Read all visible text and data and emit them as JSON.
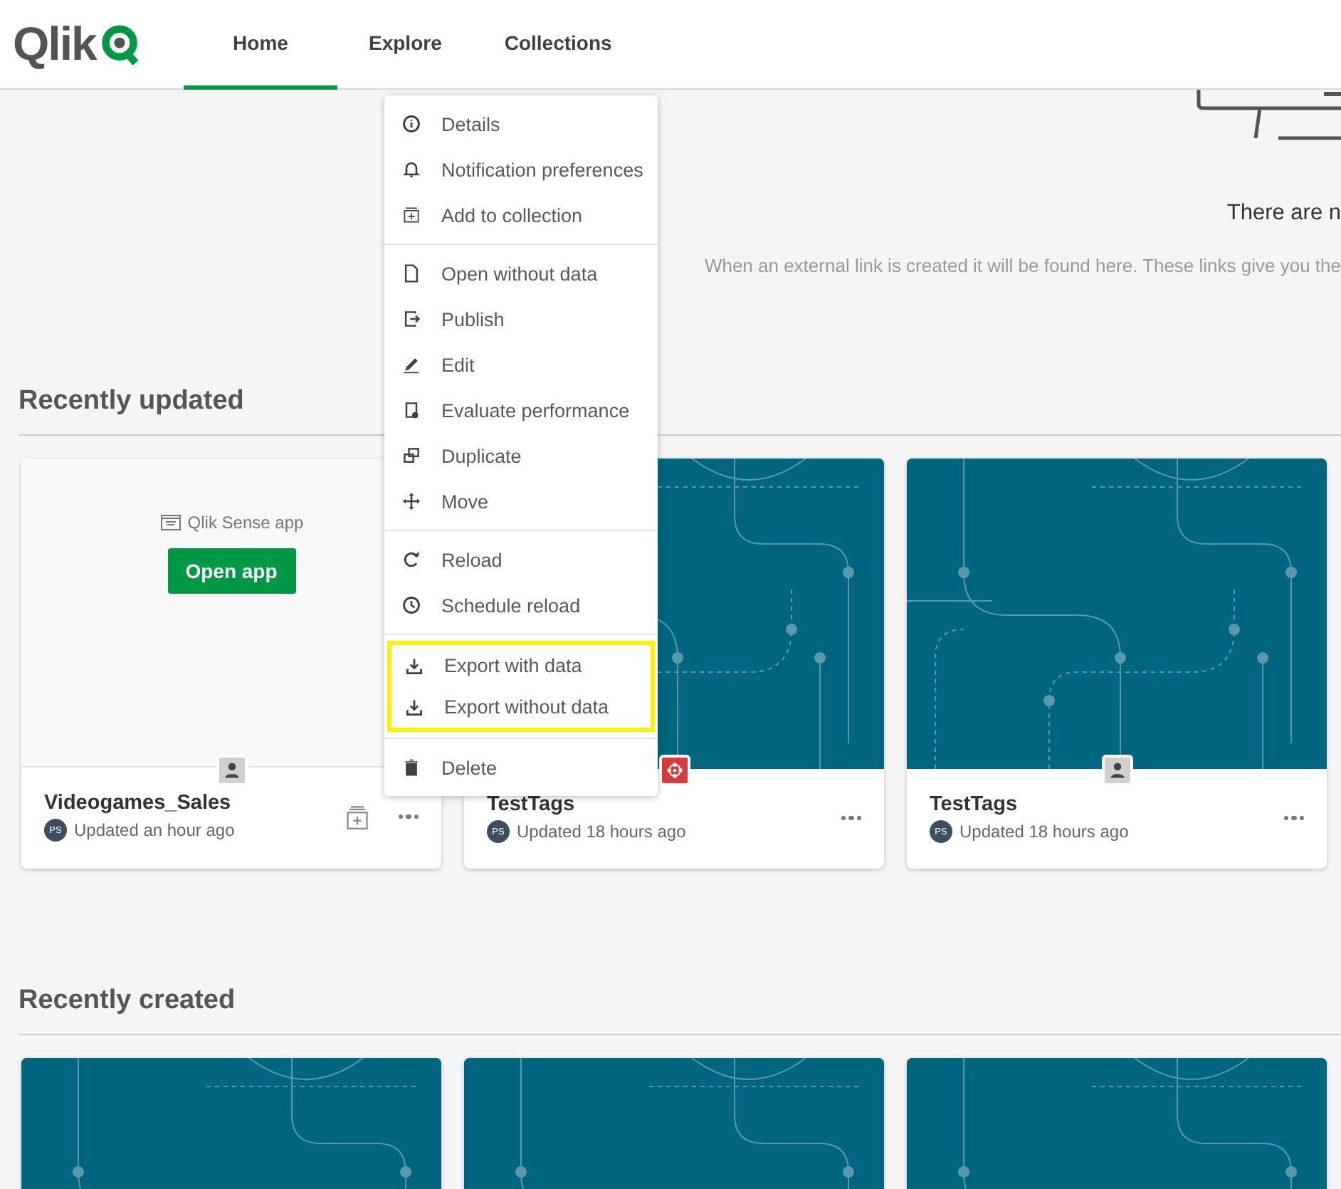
{
  "header": {
    "logo": "Qlik",
    "tabs": [
      {
        "label": "Home",
        "selected": true
      },
      {
        "label": "Explore",
        "selected": false
      },
      {
        "label": "Collections",
        "selected": false
      }
    ]
  },
  "empty_state": {
    "title": "There are n",
    "description": "When an external link is created it will be found here. These links give you the"
  },
  "sections": [
    {
      "title": "Recently updated",
      "cards": [
        {
          "kind": "app",
          "type_label": "Qlik Sense app",
          "open_button": "Open app",
          "badge": {
            "kind": "person"
          },
          "title": "Videogames_Sales",
          "avatar": "PS",
          "updated": "Updated an hour ago",
          "collection_button": true
        },
        {
          "kind": "picture",
          "badge": {
            "kind": "network"
          },
          "title": "TestTags",
          "avatar": "PS",
          "updated": "Updated 18 hours ago",
          "collection_button": false
        },
        {
          "kind": "picture",
          "badge": {
            "kind": "person"
          },
          "title": "TestTags",
          "avatar": "PS",
          "updated": "Updated 18 hours ago",
          "collection_button": false
        }
      ]
    },
    {
      "title": "Recently created"
    }
  ],
  "context_menu": {
    "groups": [
      {
        "highlighted": false,
        "items": [
          {
            "kind": "info",
            "label": "Details"
          },
          {
            "kind": "bell",
            "label": "Notification preferences"
          },
          {
            "kind": "collection",
            "label": "Add to collection"
          }
        ]
      },
      {
        "highlighted": false,
        "items": [
          {
            "kind": "file",
            "label": "Open without data"
          },
          {
            "kind": "publish",
            "label": "Publish"
          },
          {
            "kind": "edit",
            "label": "Edit"
          },
          {
            "kind": "evaluate",
            "label": "Evaluate performance"
          },
          {
            "kind": "duplicate",
            "label": "Duplicate"
          },
          {
            "kind": "move",
            "label": "Move"
          }
        ]
      },
      {
        "highlighted": false,
        "items": [
          {
            "kind": "reload",
            "label": "Reload"
          },
          {
            "kind": "schedule",
            "label": "Schedule reload"
          }
        ]
      },
      {
        "highlighted": true,
        "items": [
          {
            "kind": "export",
            "label": "Export with data"
          },
          {
            "kind": "export",
            "label": "Export without data"
          }
        ]
      },
      {
        "highlighted": false,
        "items": [
          {
            "kind": "delete",
            "label": "Delete"
          }
        ]
      }
    ]
  }
}
